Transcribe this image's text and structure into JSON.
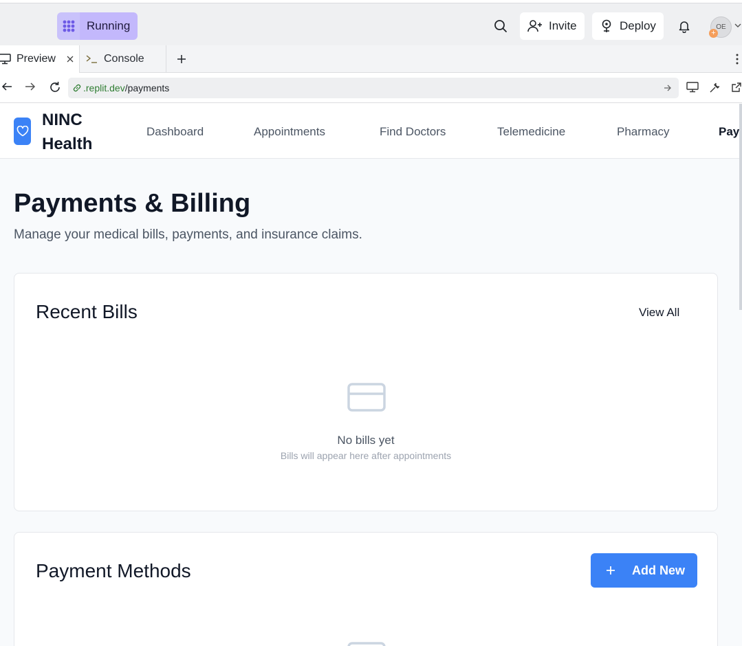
{
  "topbar": {
    "run_label": "Running",
    "invite_label": "Invite",
    "deploy_label": "Deploy",
    "avatar_initials": "OE"
  },
  "tabs": [
    {
      "label": "Preview",
      "icon": "monitor-icon",
      "closable": true,
      "active": true
    },
    {
      "label": "Console",
      "icon": "terminal-icon",
      "closable": false,
      "active": false
    }
  ],
  "url": {
    "domain": ".replit.dev",
    "path": "/payments"
  },
  "app": {
    "brand_line1": "NINC",
    "brand_line2": "Health",
    "nav": [
      "Dashboard",
      "Appointments",
      "Find Doctors",
      "Telemedicine",
      "Pharmacy",
      "Pay"
    ],
    "page_title": "Payments & Billing",
    "page_subtitle": "Manage your medical bills, payments, and insurance claims.",
    "recent_bills": {
      "title": "Recent Bills",
      "view_all": "View All",
      "empty_title": "No bills yet",
      "empty_subtitle": "Bills will appear here after appointments"
    },
    "payment_methods": {
      "title": "Payment Methods",
      "add_label": "Add New"
    }
  },
  "colors": {
    "accent": "#3b82f6",
    "run_badge": "#c3b8fc",
    "url_domain": "#2f7d32"
  }
}
